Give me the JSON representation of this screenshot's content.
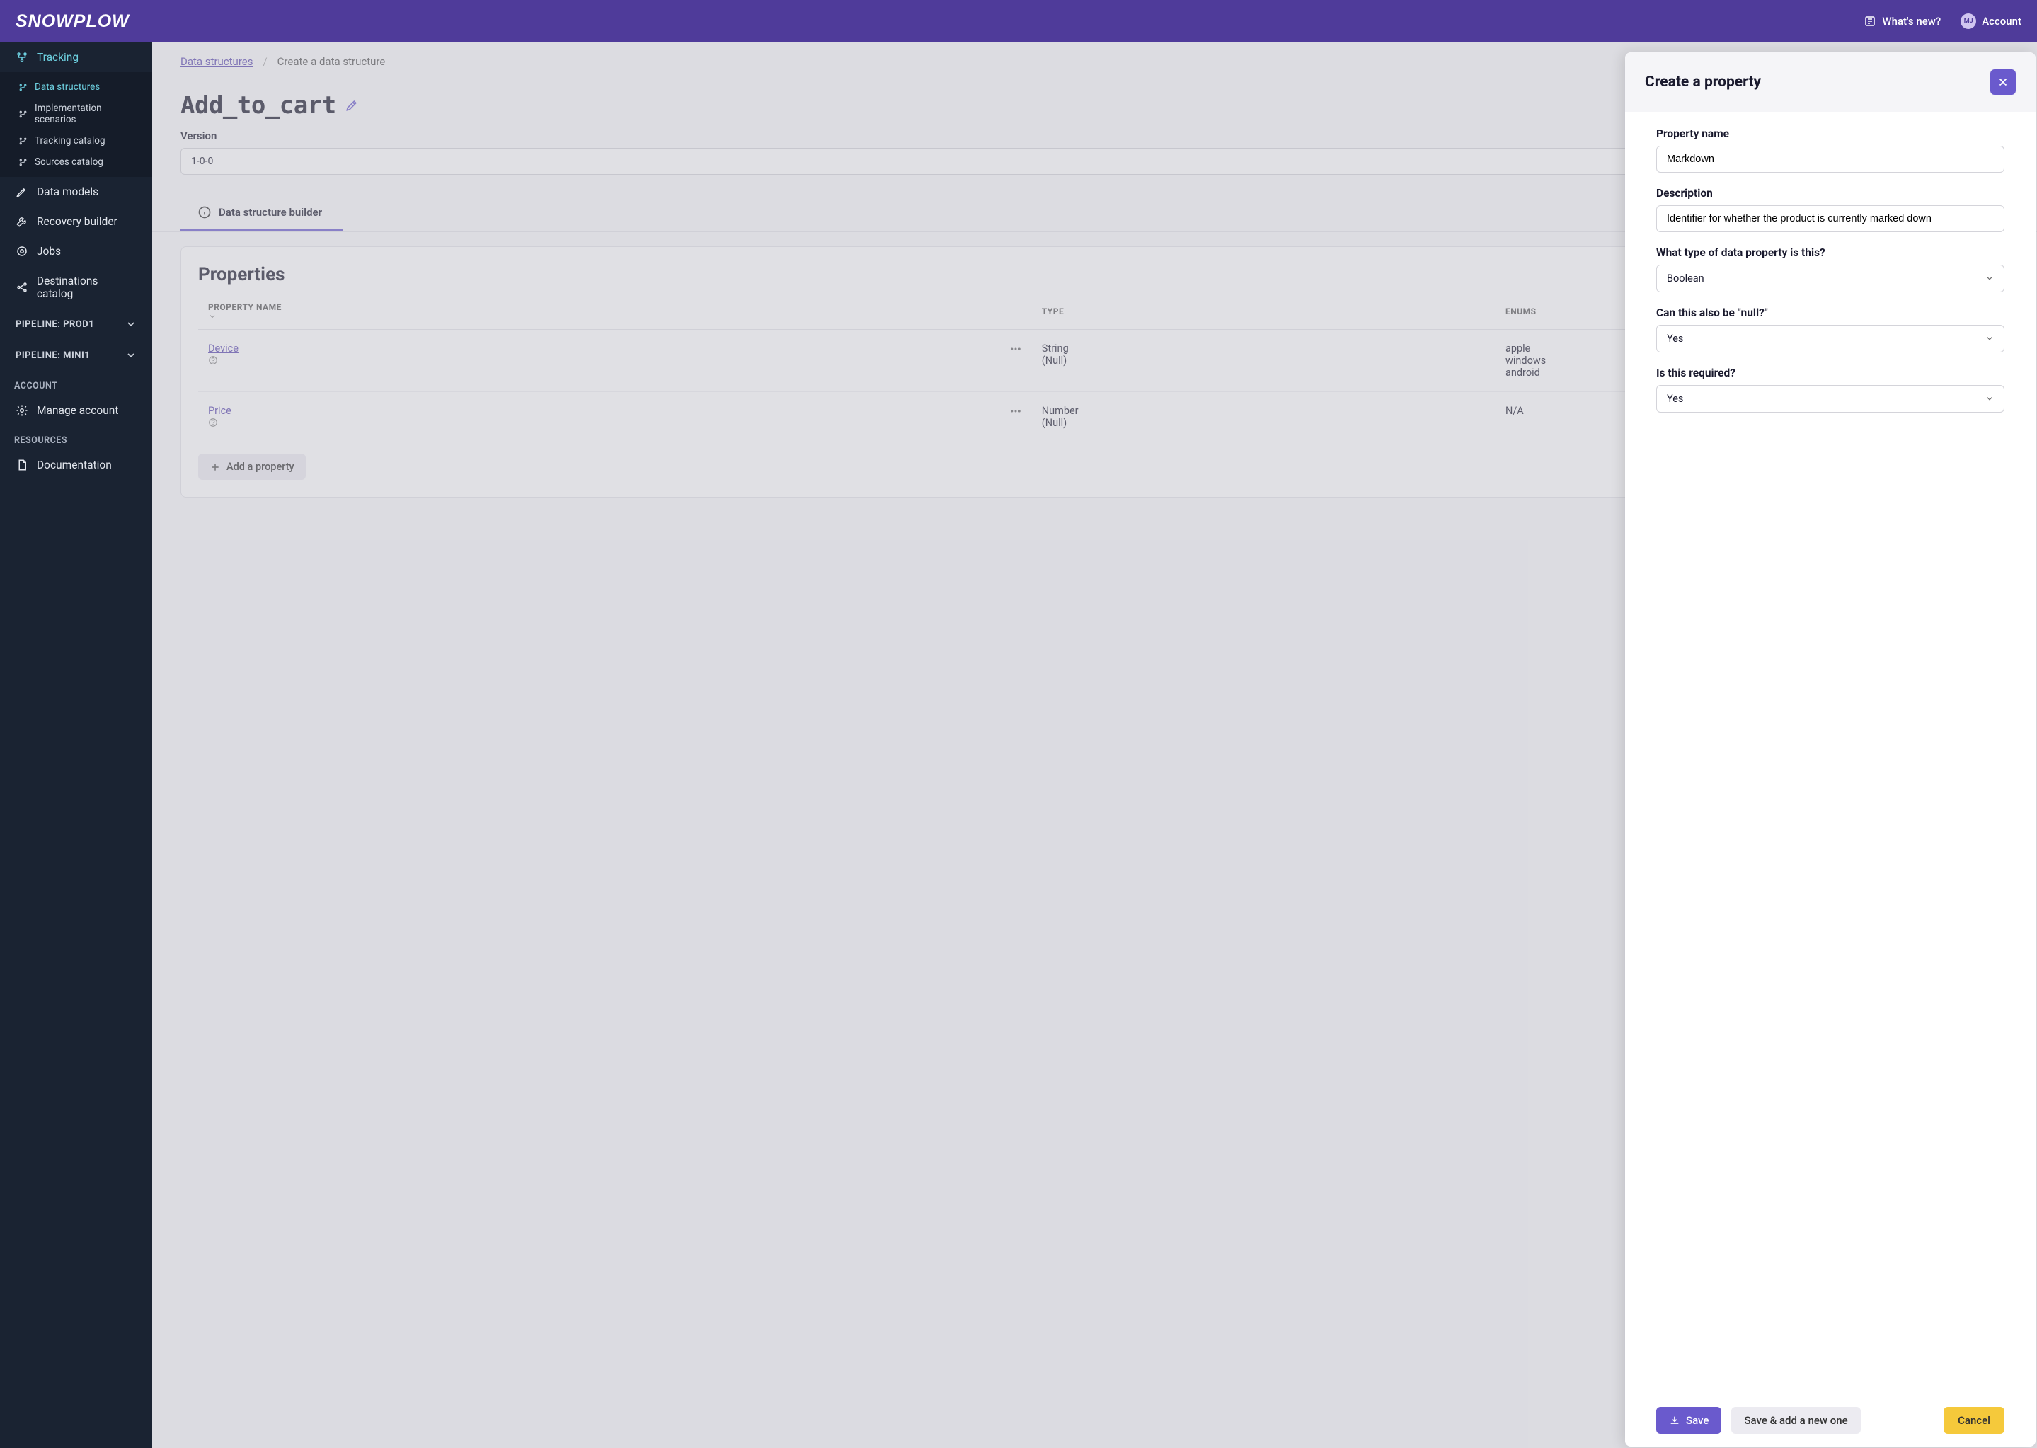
{
  "header": {
    "logo_text": "SNOWPLOW",
    "whats_new": "What's new?",
    "account_label": "Account",
    "avatar_initials": "MJ"
  },
  "sidebar": {
    "top_items": [
      {
        "label": "Tracking",
        "icon": "network-icon",
        "active": true
      },
      {
        "label": "Data models",
        "icon": "pencil-line-icon",
        "active": false
      },
      {
        "label": "Recovery builder",
        "icon": "wrench-icon",
        "active": false
      },
      {
        "label": "Jobs",
        "icon": "gear-ring-icon",
        "active": false
      },
      {
        "label": "Destinations catalog",
        "icon": "destinations-icon",
        "active": false
      }
    ],
    "tracking_sub": [
      {
        "label": "Data structures",
        "active": true
      },
      {
        "label": "Implementation scenarios",
        "active": false
      },
      {
        "label": "Tracking catalog",
        "active": false
      },
      {
        "label": "Sources catalog",
        "active": false
      }
    ],
    "pipelines": [
      {
        "label": "PIPELINE: PROD1"
      },
      {
        "label": "PIPELINE: MINI1"
      }
    ],
    "account_section_label": "ACCOUNT",
    "manage_account": "Manage account",
    "resources_section_label": "RESOURCES",
    "documentation": "Documentation"
  },
  "breadcrumb": {
    "root": "Data structures",
    "current": "Create a data structure"
  },
  "page": {
    "title": "Add_to_cart",
    "version_label": "Version",
    "version_value": "1-0-0",
    "tab_label": "Data structure builder"
  },
  "properties": {
    "heading": "Properties",
    "columns": {
      "name": "PROPERTY NAME",
      "type": "TYPE",
      "enums": "ENUMS"
    },
    "rows": [
      {
        "name": "Device",
        "type": "String\n(Null)",
        "enums": "apple\nwindows\nandroid"
      },
      {
        "name": "Price",
        "type": "Number\n(Null)",
        "enums": "N/A"
      }
    ],
    "add_button": "Add a property"
  },
  "panel": {
    "title": "Create a property",
    "name_label": "Property name",
    "name_value": "Markdown",
    "desc_label": "Description",
    "desc_value": "Identifier for whether the product is currently marked down",
    "type_label": "What type of data property is this?",
    "type_value": "Boolean",
    "null_label": "Can this also be \"null?\"",
    "null_value": "Yes",
    "required_label": "Is this required?",
    "required_value": "Yes",
    "save": "Save",
    "save_add": "Save & add a new one",
    "cancel": "Cancel"
  }
}
